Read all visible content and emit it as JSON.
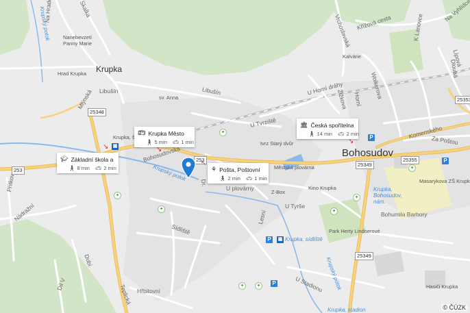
{
  "map": {
    "towns": {
      "krupka": "Krupka",
      "bohosudov": "Bohosudov"
    },
    "streets": {
      "libusin": "Libušín",
      "libusin2": "Libušín",
      "mlynska": "Mlýnská",
      "na_hrad": "Na Hradě",
      "skalka": "Skalka",
      "vrchoslavska": "Vrchoslavská",
      "krizova_cesta": "Křížová cesta",
      "k_lanovce": "K Lanovce",
      "na_vyhlidce": "Na Vyhlídce",
      "lipova": "Lípová",
      "dlouha": "Dlouhá",
      "wolkerova": "Wolkerova",
      "u_horni_drahy": "U Horní dráhy",
      "zizkova": "Žižkova",
      "horni": "Horní",
      "u_tvrziste": "U Tvrziště",
      "komenskeho": "Komenského",
      "za_po_stou": "Za Poštou",
      "bohosudovska": "Bohosudovská",
      "u_plovarny": "U plovárny",
      "dr": "Dr.",
      "sidliste": "Sídliště",
      "lesni": "Lesní",
      "u_tyrse": "U Tyrše",
      "bohumila_barhory": "Bohumila Barhory",
      "u_stadionu": "U Stadionu",
      "nedrzel": "Nádražní",
      "dubi": "Dubí",
      "dil_v": "Díl V",
      "teplicka": "Teplická",
      "hrbitovni": "Hřbitovní",
      "prictin": "Přítkov",
      "kostelni": "Kostelní"
    },
    "pois": {
      "nanebevzeti": "Nanebevzetí\nPanny Marie",
      "hrad_krupka": "Hrad Krupka",
      "sv_anna": "sv. Anna",
      "kalvarie": "Kalvárie",
      "tvrz": "tvrz Starý dvůr",
      "plovarna": "Městská plovárna",
      "kino": "Kino Krupka",
      "z_box": "Z-Box",
      "masarykova": "Masarykova ZŠ Krupka",
      "park": "Park Herty Lindnerové",
      "hasici": "Hasiči Krupka",
      "krupka_skola": "Krupka, škola",
      "krupka_bohosudov_nam": "Krupka,\nBohosudov,\nnám.",
      "krupka_sidliste": "Krupka, sídliště",
      "krupka_stadion": "Krupka, stadion"
    },
    "water": {
      "krupsky_potok": "Krupský potok",
      "krupsky_potok2": "Krupský potok",
      "krupsky_potok3": "Krupský potok"
    },
    "road_numbers": {
      "r253a": "253",
      "r253b": "253",
      "r25348": "25348",
      "r25353": "25353",
      "r25349a": "25349",
      "r25349b": "25349",
      "r25355": "25355"
    },
    "copyright": "© ČÚZK"
  },
  "cards": [
    {
      "name": "Krupka Město",
      "icon": "bus-icon",
      "walk": "5 min",
      "drive": "1 min"
    },
    {
      "name": "Základní škola a ...",
      "icon": "school-icon",
      "walk": "8 min",
      "drive": "2 min"
    },
    {
      "name": "Pošta, Poštovní",
      "icon": "post-icon",
      "walk": "2 min",
      "drive": "1 min"
    },
    {
      "name": "Česká spořitelna",
      "icon": "bank-icon",
      "walk": "14 min",
      "drive": "2 min"
    }
  ],
  "colors": {
    "background": "#ececec",
    "forest": "#cfe3c3",
    "road_major": "#f7d27a",
    "road_minor": "#ffffff",
    "water": "#8ab9ee",
    "pin": "#1e7bd6",
    "arrow": "#c0392b"
  }
}
